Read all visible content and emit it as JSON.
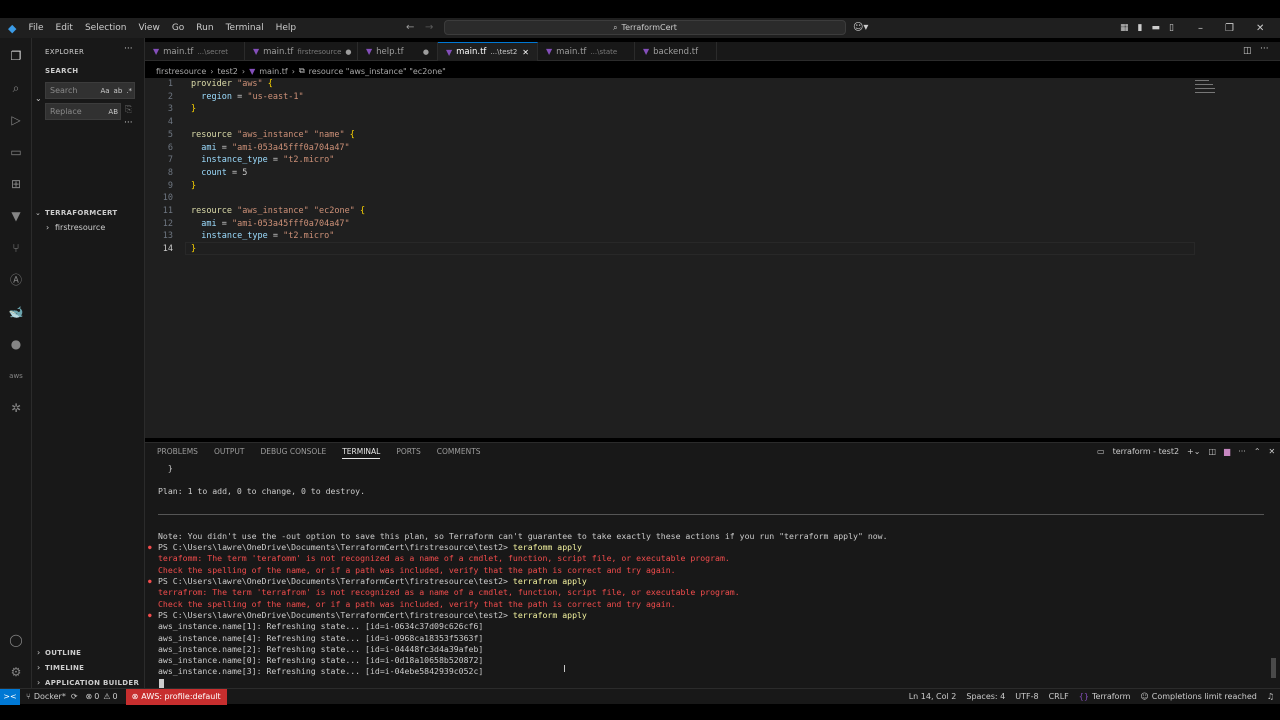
{
  "menu": [
    "File",
    "Edit",
    "Selection",
    "View",
    "Go",
    "Run",
    "Terminal",
    "Help"
  ],
  "search": {
    "text": "TerraformCert"
  },
  "sidebar": {
    "explorer_label": "EXPLORER",
    "search_label": "SEARCH",
    "search_placeholder": "Search",
    "replace_placeholder": "Replace",
    "search_opts": [
      "Aa",
      "ab",
      ".*"
    ],
    "replace_opt": "AB",
    "folder_label": "TERRAFORMCERT",
    "folder_item": "firstresource",
    "outline_label": "OUTLINE",
    "timeline_label": "TIMELINE",
    "appbuilder_label": "APPLICATION BUILDER"
  },
  "tabs": [
    {
      "name": "main.tf",
      "desc": "...\\secret"
    },
    {
      "name": "main.tf",
      "desc": "firstresource",
      "dirty": "●"
    },
    {
      "name": "help.tf",
      "desc": "",
      "dirty": "●"
    },
    {
      "name": "main.tf",
      "desc": "...\\test2",
      "close": "✕"
    },
    {
      "name": "main.tf",
      "desc": "...\\state"
    },
    {
      "name": "backend.tf",
      "desc": ""
    }
  ],
  "breadcrumb": [
    "firstresource",
    "test2",
    "main.tf",
    "resource \"aws_instance\" \"ec2one\""
  ],
  "code": [
    {
      "n": "1",
      "t": "provider \"aws\" {"
    },
    {
      "n": "2",
      "t": "  region = \"us-east-1\""
    },
    {
      "n": "3",
      "t": "}"
    },
    {
      "n": "4",
      "t": ""
    },
    {
      "n": "5",
      "t": "resource \"aws_instance\" \"name\" {"
    },
    {
      "n": "6",
      "t": "  ami = \"ami-053a45fff0a704a47\""
    },
    {
      "n": "7",
      "t": "  instance_type = \"t2.micro\""
    },
    {
      "n": "8",
      "t": "  count = 5"
    },
    {
      "n": "9",
      "t": "}"
    },
    {
      "n": "10",
      "t": ""
    },
    {
      "n": "11",
      "t": "resource \"aws_instance\" \"ec2one\" {"
    },
    {
      "n": "12",
      "t": "  ami = \"ami-053a45fff0a704a47\""
    },
    {
      "n": "13",
      "t": "  instance_type = \"t2.micro\""
    },
    {
      "n": "14",
      "t": "}"
    }
  ],
  "panel": {
    "tabs": [
      "PROBLEMS",
      "OUTPUT",
      "DEBUG CONSOLE",
      "TERMINAL",
      "PORTS",
      "COMMENTS"
    ],
    "active_tab": "TERMINAL",
    "terminal_name": "terraform - test2"
  },
  "terminal": [
    {
      "t": "  }",
      "c": ""
    },
    {
      "t": "",
      "c": ""
    },
    {
      "t": "Plan: 1 to add, 0 to change, 0 to destroy.",
      "c": ""
    },
    {
      "t": "",
      "c": ""
    },
    {
      "t": "",
      "c": ""
    },
    {
      "t": "",
      "c": ""
    },
    {
      "t": "Note: You didn't use the -out option to save this plan, so Terraform can't guarantee to take exactly these actions if you run \"terraform apply\" now.",
      "c": ""
    },
    {
      "t": "PS C:\\Users\\lawre\\OneDrive\\Documents\\TerraformCert\\firstresource\\test2> terafomm apply",
      "c": "ps"
    },
    {
      "t": "terafomm: The term 'terafomm' is not recognized as a name of a cmdlet, function, script file, or executable program.",
      "c": "err"
    },
    {
      "t": "Check the spelling of the name, or if a path was included, verify that the path is correct and try again.",
      "c": "err"
    },
    {
      "t": "PS C:\\Users\\lawre\\OneDrive\\Documents\\TerraformCert\\firstresource\\test2> terrafrom apply",
      "c": "ps"
    },
    {
      "t": "terrafrom: The term 'terrafrom' is not recognized as a name of a cmdlet, function, script file, or executable program.",
      "c": "err"
    },
    {
      "t": "Check the spelling of the name, or if a path was included, verify that the path is correct and try again.",
      "c": "err"
    },
    {
      "t": "PS C:\\Users\\lawre\\OneDrive\\Documents\\TerraformCert\\firstresource\\test2> terraform apply",
      "c": "ps"
    },
    {
      "t": "aws_instance.name[1]: Refreshing state... [id=i-0634c37d09c626cf6]",
      "c": ""
    },
    {
      "t": "aws_instance.name[4]: Refreshing state... [id=i-0968ca18353f5363f]",
      "c": ""
    },
    {
      "t": "aws_instance.name[2]: Refreshing state... [id=i-04448fc3d4a39afeb]",
      "c": ""
    },
    {
      "t": "aws_instance.name[0]: Refreshing state... [id=i-0d18a10658b520872]",
      "c": ""
    },
    {
      "t": "aws_instance.name[3]: Refreshing state... [id=i-04ebe5842939c052c]",
      "c": ""
    }
  ],
  "status": {
    "remote": "><",
    "docker": "Docker*",
    "errors": "0",
    "warnings": "0",
    "aws": "AWS: profile:default",
    "cursor": "Ln 14, Col 2",
    "spaces": "Spaces: 4",
    "encoding": "UTF-8",
    "eol": "CRLF",
    "language": "Terraform",
    "completions": "Completions limit reached"
  },
  "colors": {
    "accent": "#0078d4",
    "aws_badge": "#c72e2e",
    "remote": "#0078d4"
  }
}
